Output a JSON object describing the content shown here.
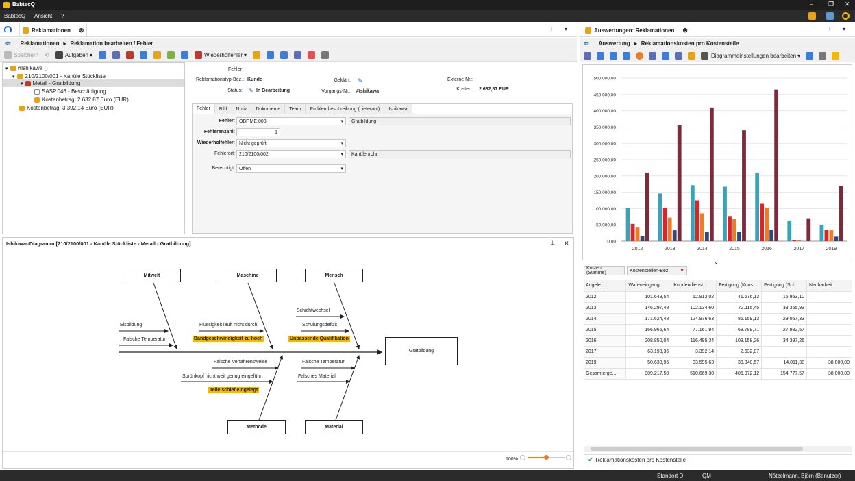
{
  "app": {
    "title": "BabtecQ",
    "menu": [
      "BabtecQ",
      "Ansicht",
      "?"
    ]
  },
  "left_tab": {
    "label": "Reklamationen",
    "breadcrumb_root": "Reklamationen",
    "breadcrumb_current": "Reklamation bearbeiten / Fehler"
  },
  "toolbar": {
    "save": "Speichern",
    "tasks": "Aufgaben",
    "repeat": "Wiederholfehler"
  },
  "tree": {
    "root": "#Ishikawa ()",
    "item1": "210/2100/001 - Kanüle Stückliste",
    "item2": "Metall - Gratbildung",
    "item3": "SASP.046 - Beschädigung",
    "item4": "Kostenbetrag: 2.632,87 Euro (EUR)",
    "item5": "Kostenbetrag: 3.392,14 Euro (EUR)"
  },
  "form": {
    "section": "Fehler",
    "type_label": "Reklamationstyp-Bez.:",
    "type_value": "Kunde",
    "status_label": "Status:",
    "status_value": "In Bearbeitung",
    "clarified_label": "Geklärt:",
    "proc_label": "Vorgangs-Nr.:",
    "proc_value": "#Ishikawa",
    "ext_label": "Externe Nr.:",
    "cost_label": "Kosten:",
    "cost_value": "2.632,87 EUR",
    "tabs": [
      "Fehler",
      "Bild",
      "Notiz",
      "Dokumente",
      "Team",
      "Problembeschreibung (Lieferant)",
      "Ishikawa"
    ],
    "f1_label": "Fehler:",
    "f1_value": "OBF.ME.003",
    "f1_desc": "Gratbildung",
    "f2_label": "Fehleranzahl:",
    "f2_value": "1",
    "f3_label": "Wiederholfehler:",
    "f3_value": "Nicht geprüft",
    "f4_label": "Fehlerort:",
    "f4_value": "210/2100/002",
    "f4_desc": "Kanülenrohr",
    "f5_label": "Berechtigt:",
    "f5_value": "Offen"
  },
  "ishikawa": {
    "title": "Ishikawa-Diagramm [210/2100/001 - Kanüle Stückliste - Metall - Gratbildung]",
    "categories": {
      "mitwelt": "Mitwelt",
      "maschine": "Maschine",
      "mensch": "Mensch",
      "methode": "Methode",
      "material": "Material"
    },
    "effect": "Gratbildung",
    "causes": {
      "c1": "Eisbildung",
      "c2": "Falsche Temperatur",
      "c3": "Flüssigkeit läuft nicht durch",
      "c4": "Bandgeschwindigkeit zu hoch",
      "c5": "Schichtwechsel",
      "c6": "Schulungsdefizit",
      "c7": "Unpassende Qualifikation",
      "c8": "Falsche Verfahrensweise",
      "c9": "Sprühkopf nicht weit genug eingeführt",
      "c10": "Teile schief eingelegt",
      "c11": "Falsche Temperatur",
      "c12": "Falsches Material"
    },
    "zoom": "100%"
  },
  "right_tab": {
    "label": "Auswertungen: Reklamationen",
    "breadcrumb_root": "Auswertung",
    "breadcrumb_current": "Reklamationskosten pro Kostenstelle",
    "diagram_settings": "Diagrammeinstellungen bearbeiten"
  },
  "chart_data": {
    "type": "bar",
    "categories": [
      "2012",
      "2013",
      "2014",
      "2015",
      "2016",
      "2017",
      "2019"
    ],
    "ylim": [
      0,
      500000
    ],
    "yticks": [
      "0,00",
      "50.000,00",
      "100.000,00",
      "150.000,00",
      "200.000,00",
      "250.000,00",
      "300.000,00",
      "350.000,00",
      "400.000,00",
      "450.000,00",
      "500.000,00"
    ],
    "series": [
      {
        "color": "#3aa3b8",
        "values": [
          101649.54,
          146297.48,
          171624.48,
          166966.64,
          208850.04,
          63198.36,
          50630.96
        ]
      },
      {
        "color": "#d9262b",
        "values": [
          52913.02,
          102134.6,
          124976.63,
          77161.94,
          116495.34,
          3392.14,
          33595.63
        ]
      },
      {
        "color": "#ee7a2a",
        "values": [
          41676.13,
          72115.45,
          85159.13,
          68789.71,
          103158.26,
          2632.87,
          33340.57
        ]
      },
      {
        "color": "#2f4a7a",
        "values": [
          15953.1,
          33365.93,
          29067.33,
          27982.57,
          34397.26,
          0,
          14011.38
        ]
      },
      {
        "color": "#7a2b3d",
        "values": [
          210000,
          355000,
          410000,
          340000,
          465000,
          70000,
          170000
        ]
      }
    ]
  },
  "pivot": {
    "filter1": "Kosten (Summe)",
    "filter2": "Kostenstellen-Bez.",
    "headers": [
      "Angele...",
      "Wareneingang",
      "Kundendienst",
      "Fertigung (Kuns...",
      "Fertigung (Sch...",
      "Nacharbeit"
    ],
    "rows": [
      [
        "2012",
        "101.649,54",
        "52.913,02",
        "41.676,13",
        "15.953,10",
        ""
      ],
      [
        "2013",
        "146.297,48",
        "102.134,60",
        "72.115,45",
        "33.365,93",
        ""
      ],
      [
        "2014",
        "171.624,48",
        "124.976,63",
        "85.159,13",
        "29.067,33",
        ""
      ],
      [
        "2015",
        "166.966,64",
        "77.161,94",
        "68.789,71",
        "27.982,57",
        ""
      ],
      [
        "2016",
        "208.850,04",
        "116.495,34",
        "103.158,26",
        "34.397,26",
        ""
      ],
      [
        "2017",
        "63.198,36",
        "3.392,14",
        "2.632,87",
        "",
        ""
      ],
      [
        "2019",
        "50.630,96",
        "33.595,63",
        "33.340,57",
        "14.011,38",
        "38.000,00"
      ],
      [
        "Gesamterge...",
        "909.217,50",
        "510.669,30",
        "406.872,12",
        "154.777,57",
        "38.000,00"
      ]
    ],
    "footer": "Reklamationskosten pro Kostenstelle"
  },
  "status": {
    "site": "Standort D",
    "module": "QM",
    "user": "Nötzelmann, Björn (Benutzer)"
  }
}
